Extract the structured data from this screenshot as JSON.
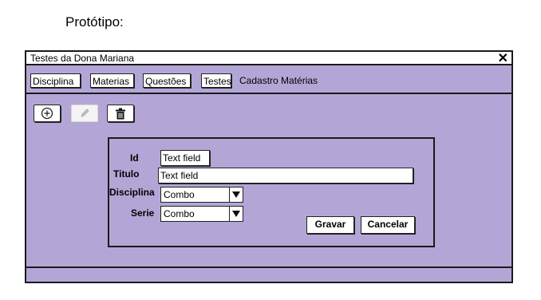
{
  "page": {
    "heading": "Protótipo:"
  },
  "window": {
    "title": "Testes da Dona Mariana",
    "close_symbol": "✕"
  },
  "menu": {
    "tabs": [
      "Disciplina",
      "Materias",
      "Questões",
      "Testes"
    ],
    "current": "Cadastro Matérias"
  },
  "toolbar": {
    "add_icon": "add-circle-icon",
    "edit_icon": "pencil-icon",
    "delete_icon": "trash-icon",
    "edit_disabled": true
  },
  "form": {
    "id_label": "Id",
    "id_value": "Text field",
    "titulo_label": "Titulo",
    "titulo_value": "Text field",
    "disciplina_label": "Disciplina",
    "disciplina_value": "Combo",
    "serie_label": "Serie",
    "serie_value": "Combo",
    "save_label": "Gravar",
    "cancel_label": "Cancelar"
  },
  "colors": {
    "window_bg": "#b3a6d6",
    "border": "#1a1a1a"
  }
}
